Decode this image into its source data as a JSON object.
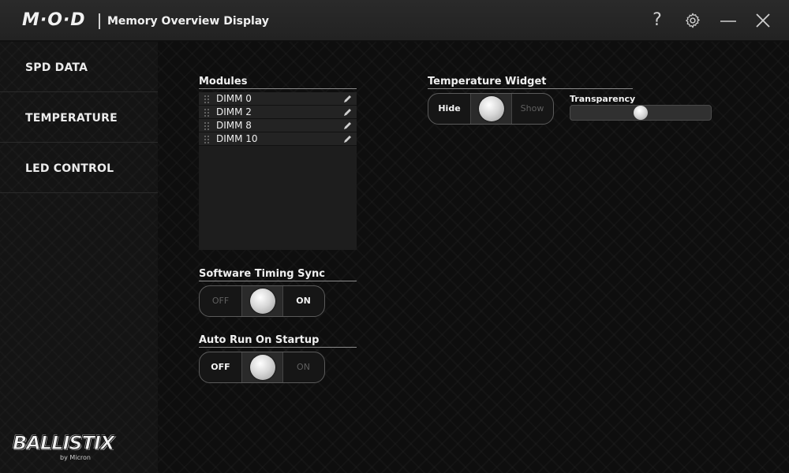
{
  "app": {
    "logo": "M·O·D",
    "title": "Memory Overview Display"
  },
  "titlebar": {
    "help": "?",
    "gear": "gear-icon",
    "minimize": "minimize-icon",
    "close": "close-icon"
  },
  "sidebar": {
    "items": [
      {
        "label": "SPD DATA"
      },
      {
        "label": "TEMPERATURE"
      },
      {
        "label": "LED CONTROL"
      }
    ],
    "brand": {
      "name": "BALLISTIX",
      "sub": "by Micron"
    }
  },
  "modules": {
    "label": "Modules",
    "items": [
      {
        "name": "DIMM 0"
      },
      {
        "name": "DIMM 2"
      },
      {
        "name": "DIMM 8"
      },
      {
        "name": "DIMM 10"
      }
    ]
  },
  "software_timing_sync": {
    "label": "Software Timing Sync",
    "off": "OFF",
    "on": "ON",
    "state": "ON"
  },
  "auto_run": {
    "label": "Auto Run On Startup",
    "off": "OFF",
    "on": "ON",
    "state": "OFF"
  },
  "temperature_widget": {
    "label": "Temperature Widget",
    "hide": "Hide",
    "show": "Show",
    "state": "Hide"
  },
  "transparency": {
    "label": "Transparency",
    "value_fraction": 0.5
  },
  "colors": {
    "accent": "#f0f0f0",
    "inactive": "#5e5e5e",
    "background": "#0f0f0f"
  }
}
